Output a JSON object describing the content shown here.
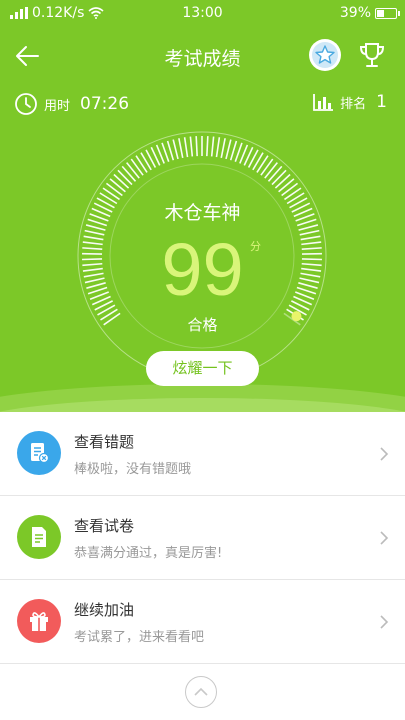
{
  "status": {
    "speed": "0.12K/s",
    "time": "13:00",
    "battery": "39%"
  },
  "header": {
    "title": "考试成绩"
  },
  "stats": {
    "time_label": "用时",
    "time_value": "07:26",
    "rank_label": "排名",
    "rank_value": "1"
  },
  "score": {
    "user": "木仓车神",
    "value": "99",
    "unit": "分",
    "result": "合格",
    "share_label": "炫耀一下",
    "level": 0.99
  },
  "items": [
    {
      "title": "查看错题",
      "subtitle": "棒极啦，没有错题哦",
      "color": "#3aa7ea",
      "icon": "error-note-icon"
    },
    {
      "title": "查看试卷",
      "subtitle": "恭喜满分通过，真是厉害!",
      "color": "#7cc828",
      "icon": "document-icon"
    },
    {
      "title": "继续加油",
      "subtitle": "考试累了，进来看看吧",
      "color": "#f25b5b",
      "icon": "gift-icon"
    }
  ],
  "colors": {
    "accent": "#7cc828",
    "score": "#d9f57a"
  }
}
